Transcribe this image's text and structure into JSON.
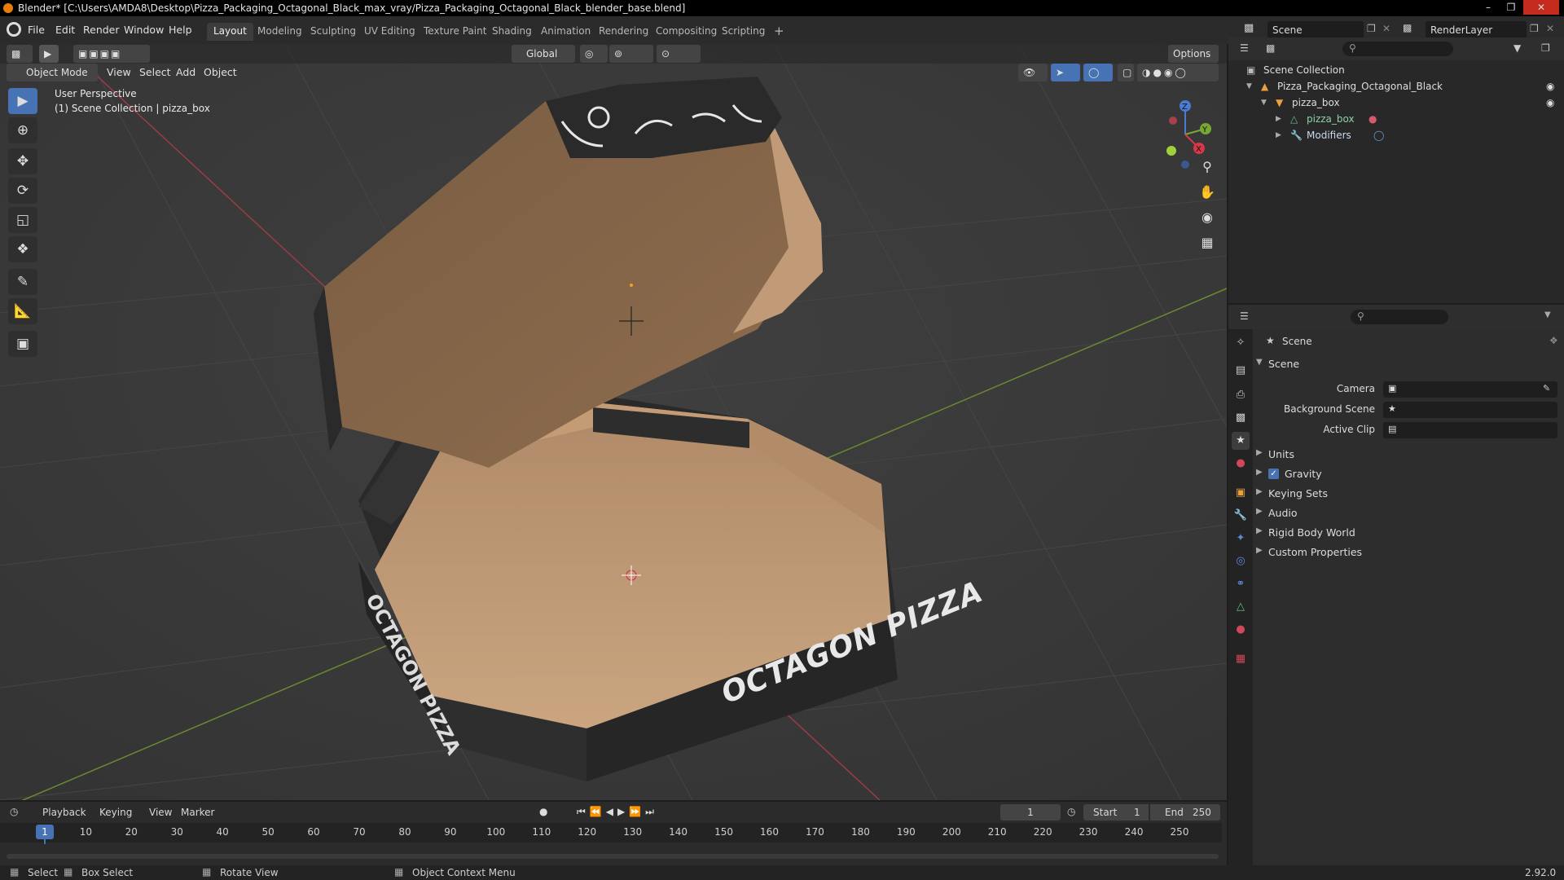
{
  "titlebar": {
    "title": "Blender* [C:\\Users\\AMDA8\\Desktop\\Pizza_Packaging_Octagonal_Black_max_vray/Pizza_Packaging_Octagonal_Black_blender_base.blend]"
  },
  "menu": [
    "File",
    "Edit",
    "Render",
    "Window",
    "Help"
  ],
  "workspaces": [
    "Layout",
    "Modeling",
    "Sculpting",
    "UV Editing",
    "Texture Paint",
    "Shading",
    "Animation",
    "Rendering",
    "Compositing",
    "Scripting"
  ],
  "workspace_add": "+",
  "scene_field": "Scene",
  "renderlayer_field": "RenderLayer",
  "viewport": {
    "transform_orientation": "Global",
    "options": "Options",
    "mode": "Object Mode",
    "menus": [
      "View",
      "Select",
      "Add",
      "Object"
    ],
    "overlay_title": "User Perspective",
    "overlay_sub": "(1) Scene Collection | pizza_box",
    "gizmo_axes": [
      "Z",
      "Y",
      "X"
    ]
  },
  "box_text": {
    "front": "OCTAGON PIZZA",
    "left": "OCTAGON PIZZA"
  },
  "outliner": {
    "root": "Scene Collection",
    "items": [
      {
        "label": "Pizza_Packaging_Octagonal_Black"
      },
      {
        "label": "pizza_box"
      },
      {
        "label": "pizza_box"
      },
      {
        "label": "Modifiers"
      }
    ]
  },
  "properties": {
    "context": "Scene",
    "panel": "Scene",
    "fields": [
      {
        "label": "Camera"
      },
      {
        "label": "Background Scene"
      },
      {
        "label": "Active Clip"
      }
    ],
    "subpanels": [
      "Units",
      "Gravity",
      "Keying Sets",
      "Audio",
      "Rigid Body World",
      "Custom Properties"
    ],
    "gravity_checked": true
  },
  "timeline": {
    "menus": [
      "Playback",
      "Keying",
      "View",
      "Marker"
    ],
    "current_frame": "1",
    "start_label": "Start",
    "start": "1",
    "end_label": "End",
    "end": "250",
    "ticks": [
      "1",
      "10",
      "20",
      "30",
      "40",
      "50",
      "60",
      "70",
      "80",
      "90",
      "100",
      "110",
      "120",
      "130",
      "140",
      "150",
      "160",
      "170",
      "180",
      "190",
      "200",
      "210",
      "220",
      "230",
      "240",
      "250"
    ]
  },
  "statusbar": {
    "items": [
      "Select",
      "Box Select",
      "Rotate View",
      "Object Context Menu"
    ],
    "version": "2.92.0"
  }
}
